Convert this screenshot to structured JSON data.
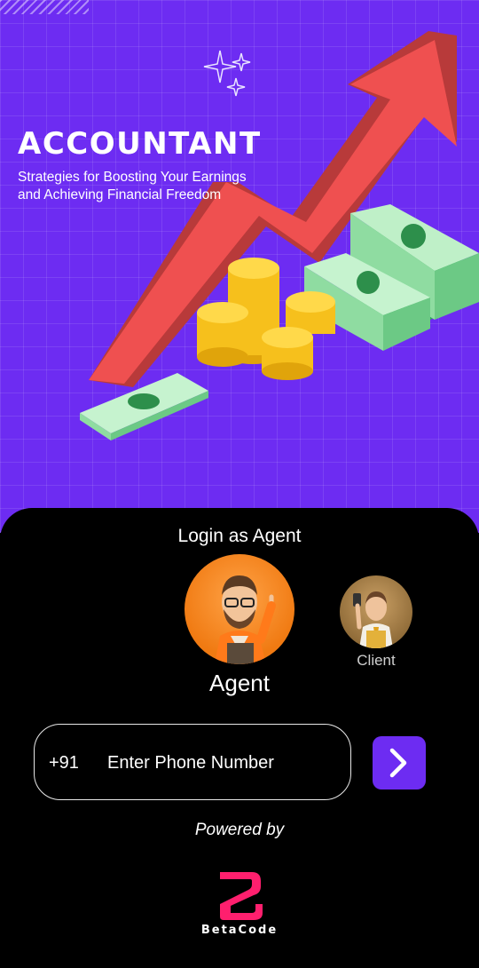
{
  "hero": {
    "title": "ACCOUNTANT",
    "subtitle": "Strategies for Boosting Your Earnings and Achieving Financial Freedom"
  },
  "login": {
    "heading": "Login as Agent",
    "selected_role": "Agent",
    "other_role": "Client"
  },
  "phone": {
    "country_code": "+91",
    "placeholder": "Enter Phone Number",
    "value": ""
  },
  "footer": {
    "powered_by": "Powered by",
    "brand": "BetaCode"
  },
  "colors": {
    "accent": "#6d2cf2",
    "brand_pink": "#ff1f6e",
    "sheet": "#000000"
  },
  "icons": {
    "submit": "chevron-right-icon",
    "logo": "betacode-logo-icon"
  }
}
